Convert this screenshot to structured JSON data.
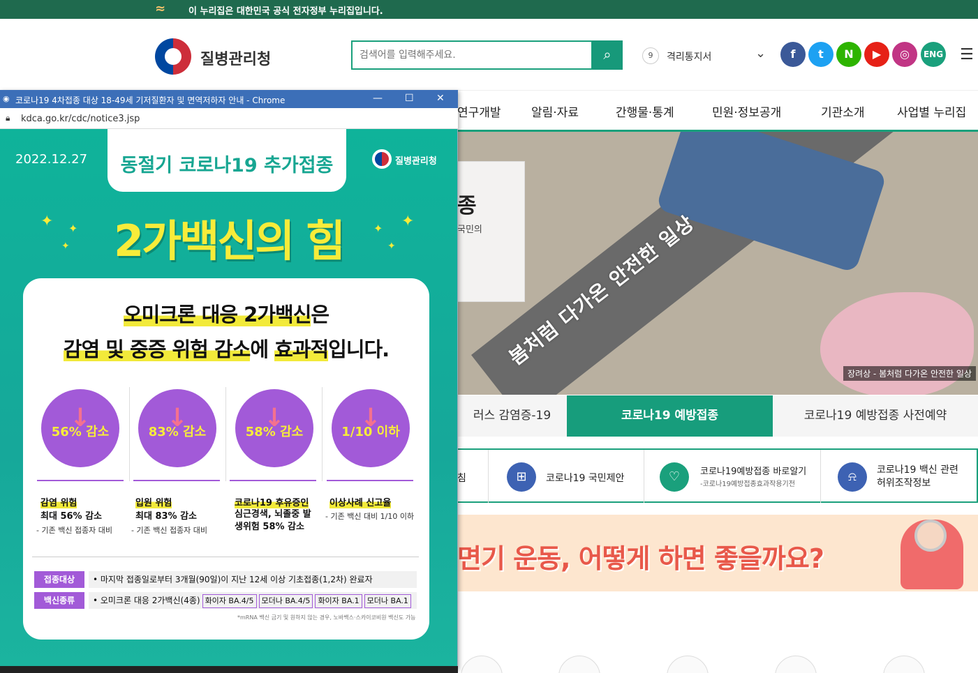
{
  "gov_banner": {
    "text": "이 누리집은 대한민국 공식 전자정부 누리집입니다."
  },
  "header": {
    "org_name": "질병관리청",
    "search_placeholder": "검색어를 입력해주세요.",
    "rank_no": "9",
    "rank_text": "격리통지서",
    "eng_label": "ENG",
    "sns": [
      {
        "icon": "facebook-icon",
        "glyph": "f",
        "color": "#3b5998"
      },
      {
        "icon": "twitter-icon",
        "glyph": "t",
        "color": "#1da1f2"
      },
      {
        "icon": "blog-icon",
        "glyph": "N",
        "color": "#2db400"
      },
      {
        "icon": "youtube-icon",
        "glyph": "▶",
        "color": "#e62117"
      },
      {
        "icon": "instagram-icon",
        "glyph": "◎",
        "color": "#c13584"
      }
    ]
  },
  "nav": {
    "items": [
      "연구개발",
      "알림·자료",
      "간행물·통계",
      "민원·정보공개",
      "기관소개",
      "사업별 누리집"
    ]
  },
  "hero": {
    "card_big": "종",
    "card_small": "국민의",
    "slogan": "봄처럼 다가온 안전한 일상",
    "caption": "장려상 - 봄처럼 다가온 안전한 일상"
  },
  "tabs": [
    "러스 감염증-19",
    "코로나19 예방접종",
    "코로나19 예방접종 사전예약"
  ],
  "quick": {
    "first_partial": "침",
    "items": [
      {
        "label": "코로나19 국민제안",
        "sub": "",
        "icon": "proposal-icon",
        "color": "#3d62b3"
      },
      {
        "label": "코로나19예방접종 바로알기",
        "sub": "-코로나19예방접종효과작용기전",
        "icon": "stethoscope-icon",
        "color": "#1aa07c"
      },
      {
        "label": "코로나19 백신 관련 허위조작정보",
        "sub": "",
        "icon": "alarm-icon",
        "color": "#3d62b3"
      }
    ]
  },
  "banner": {
    "text": "면기 운동, 어떻게 하면 좋을까요?"
  },
  "popup": {
    "window_title": "코로나19 4차접종 대상 18-49세 기저질환자 및 면역저하자 안내 - Chrome",
    "url": "kdca.go.kr/cdc/notice3.jsp",
    "date": "2022.12.27",
    "logo_text": "질병관리청",
    "tab_title": "동절기 코로나19 추가접종",
    "headline": "2가백신의 힘",
    "line1_a": "오미크론 대응 2가백신",
    "line1_b": "은",
    "line2_a": "감염 및 중증 위험 감소",
    "line2_b": "에 ",
    "line2_c": "효과적",
    "line2_d": "입니다.",
    "stats": [
      {
        "badge": "56% 감소",
        "title": "감염 위험",
        "desc": "최대 56% 감소",
        "note": "- 기존 백신 접종자 대비"
      },
      {
        "badge": "83% 감소",
        "title": "입원 위험",
        "desc": "최대 83% 감소",
        "note": "- 기존 백신 접종자 대비"
      },
      {
        "badge": "58% 감소",
        "title": "코로나19 후유증인",
        "desc": "심근경색, 뇌졸중 발생위험 58% 감소",
        "note": ""
      },
      {
        "badge": "1/10 이하",
        "title": "이상사례 신고율",
        "desc": "",
        "note": "- 기존 백신 대비 1/10 이하"
      }
    ],
    "target_label": "접종대상",
    "target_text": "• 마지막 접종일로부터 3개월(90일)이 지난 12세 이상 기초접종(1,2차) 완료자",
    "vaccine_label": "백신종류",
    "vaccine_text": "• 오미크론 대응 2가백신(4종)",
    "vaccines": [
      "화이자 BA.4/5",
      "모더나 BA.4/5",
      "화이자 BA.1",
      "모더나 BA.1"
    ],
    "footnote": "*mRNA 백신 금기 및 원하지 않는 경우, 노바백스·스카이코비원 백신도 가능"
  }
}
